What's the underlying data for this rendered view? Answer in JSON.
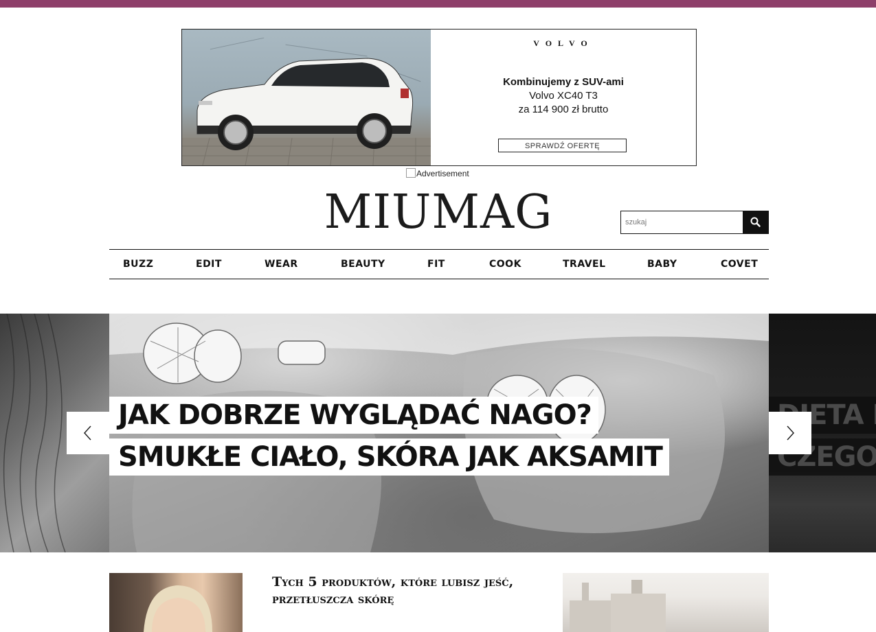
{
  "ad": {
    "brand": "VOLVO",
    "headline": "Kombinujemy z SUV-ami",
    "model": "Volvo XC40 T3",
    "price": "za 114 900 zł brutto",
    "cta": "SPRAWDŹ OFERTĘ",
    "label": "Advertisement"
  },
  "site": {
    "logo": "MIUMAG"
  },
  "search": {
    "placeholder": "szukaj"
  },
  "nav": {
    "items": [
      {
        "label": "BUZZ"
      },
      {
        "label": "EDIT"
      },
      {
        "label": "WEAR"
      },
      {
        "label": "BEAUTY"
      },
      {
        "label": "FIT"
      },
      {
        "label": "COOK"
      },
      {
        "label": "TRAVEL"
      },
      {
        "label": "BABY"
      },
      {
        "label": "COVET"
      }
    ]
  },
  "hero": {
    "title_line_1": "JAK DOBRZE WYGLĄDAĆ NAGO?",
    "title_line_2": "SMUKŁE CIAŁO, SKÓRA JAK AKSAMIT",
    "next_line_1": "DIETA NA",
    "next_line_2": "CZEGO NI"
  },
  "teasers": [
    {
      "title": "Tych 5 produktów, które lubisz jeść, przetłuszcza skórę"
    }
  ],
  "colors": {
    "topbar": "#8e3f6a",
    "text": "#111111"
  }
}
